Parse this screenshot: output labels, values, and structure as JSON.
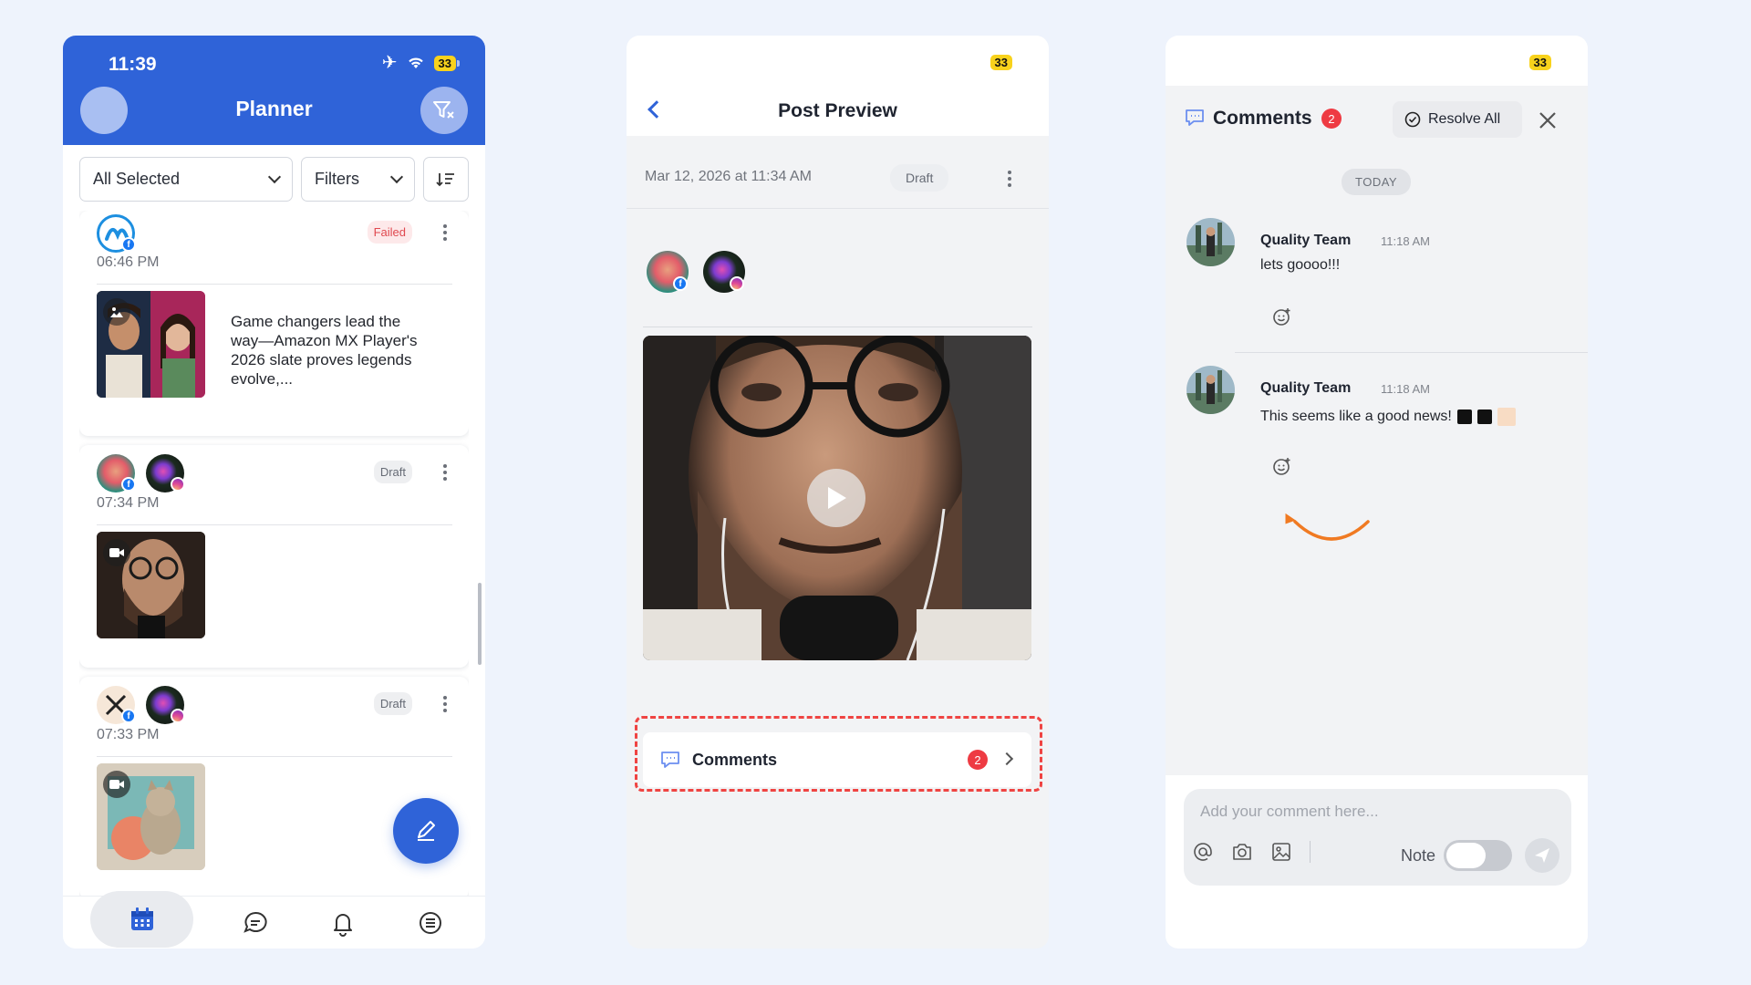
{
  "planner": {
    "status_time": "11:39",
    "battery": "33",
    "title": "Planner",
    "select_label": "All Selected",
    "filters_label": "Filters",
    "posts": [
      {
        "status": "Failed",
        "time": "06:46 PM",
        "text": "Game changers lead the way—Amazon MX Player's 2026 slate proves legends evolve,..."
      },
      {
        "status": "Draft",
        "time": "07:34 PM",
        "text": ""
      },
      {
        "status": "Draft",
        "time": "07:33 PM",
        "text": ""
      }
    ]
  },
  "preview": {
    "battery": "33",
    "title": "Post Preview",
    "meta": "Mar 12, 2026 at 11:34 AM",
    "status": "Draft",
    "comments_label": "Comments",
    "comments_count": "2"
  },
  "comments": {
    "battery": "33",
    "title": "Comments",
    "count": "2",
    "resolve_label": "Resolve All",
    "day_label": "TODAY",
    "items": [
      {
        "author": "Quality Team",
        "time": "11:18 AM",
        "text": "lets goooo!!!"
      },
      {
        "author": "Quality Team",
        "time": "11:18 AM",
        "text": "This seems like a good news!"
      }
    ],
    "input_placeholder": "Add your comment here...",
    "note_label": "Note"
  },
  "colors": {
    "brand_blue": "#2f63d8",
    "failed_red": "#e0484f",
    "badge_red": "#ee3b43",
    "highlight": "#ef4442",
    "annotation_orange": "#f07a22"
  }
}
